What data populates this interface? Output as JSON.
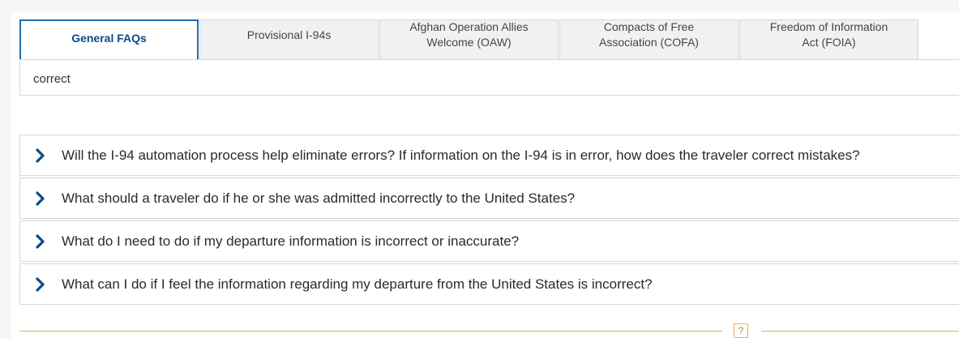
{
  "tabs": [
    {
      "label": "General FAQs",
      "active": true
    },
    {
      "label": "Provisional I-94s",
      "active": false
    },
    {
      "label": "Afghan Operation Allies\nWelcome (OAW)",
      "active": false
    },
    {
      "label": "Compacts of Free\nAssociation (COFA)",
      "active": false
    },
    {
      "label": "Freedom of Information\nAct (FOIA)",
      "active": false
    }
  ],
  "search": {
    "value": "correct"
  },
  "faqs": [
    {
      "question": "Will the I-94 automation process help eliminate errors? If information on the I-94 is in error, how does the traveler correct mistakes?"
    },
    {
      "question": "What should a traveler do if he or she was admitted incorrectly to the United States?"
    },
    {
      "question": "What do I need to do if my departure information is incorrect or inaccurate?"
    },
    {
      "question": "What can I do if I feel the information regarding my departure from the United States is incorrect?"
    }
  ],
  "footer": {
    "help_icon": "?"
  },
  "colors": {
    "accent": "#1f6fb5",
    "tab_active_text": "#0a4a8c",
    "chevron": "#0a4a8c",
    "divider": "#d8b25b"
  },
  "icons": {
    "chevron": "chevron-right-icon",
    "help": "help-icon"
  }
}
